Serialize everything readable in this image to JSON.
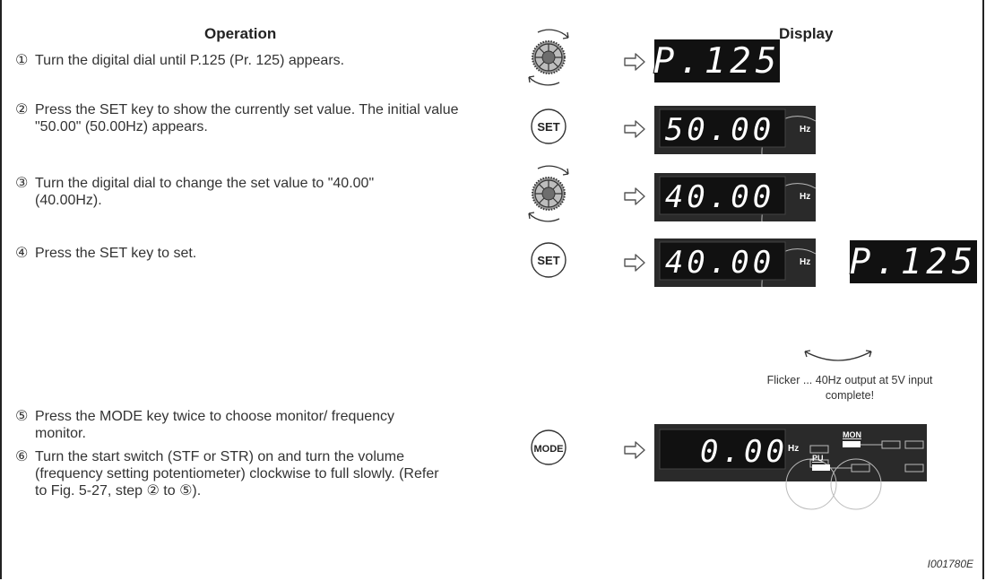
{
  "headers": {
    "operation": "Operation",
    "display": "Display"
  },
  "steps": [
    {
      "num": "①",
      "text": "Turn the digital dial until P.125 (Pr. 125) appears."
    },
    {
      "num": "②",
      "text": "Press the SET key to show the currently set value. The initial value \"50.00\" (50.00Hz) appears."
    },
    {
      "num": "③",
      "text": "Turn the digital dial to change the set value to \"40.00\" (40.00Hz)."
    },
    {
      "num": "④",
      "text": "Press the SET key to set."
    },
    {
      "num": "⑤",
      "text": "Press the MODE key twice to choose monitor/ frequency monitor."
    },
    {
      "num": "⑥",
      "text": "Turn the start switch (STF or STR) on and turn the volume (frequency setting potentiometer) clockwise to full slowly. (Refer to Fig. 5-27, step ② to ⑤)."
    }
  ],
  "displays": {
    "d1": "P.125",
    "d2": "50.00",
    "d3": "40.00",
    "d4": "40.00",
    "d4_alt": "P.125",
    "d5": "0.00"
  },
  "keys": {
    "set": "SET",
    "mode": "MODE"
  },
  "units": {
    "hz": "Hz",
    "mon": "MON",
    "pu": "PU"
  },
  "note": "Flicker ... 40Hz output at 5V input complete!",
  "figure_id": "I001780E",
  "colors": {
    "display_bg": "#111111",
    "display_segment": "#ffffff",
    "panel_bg": "#2a2a2a",
    "arrow_fill": "#ffffff",
    "arrow_stroke": "#555555"
  }
}
